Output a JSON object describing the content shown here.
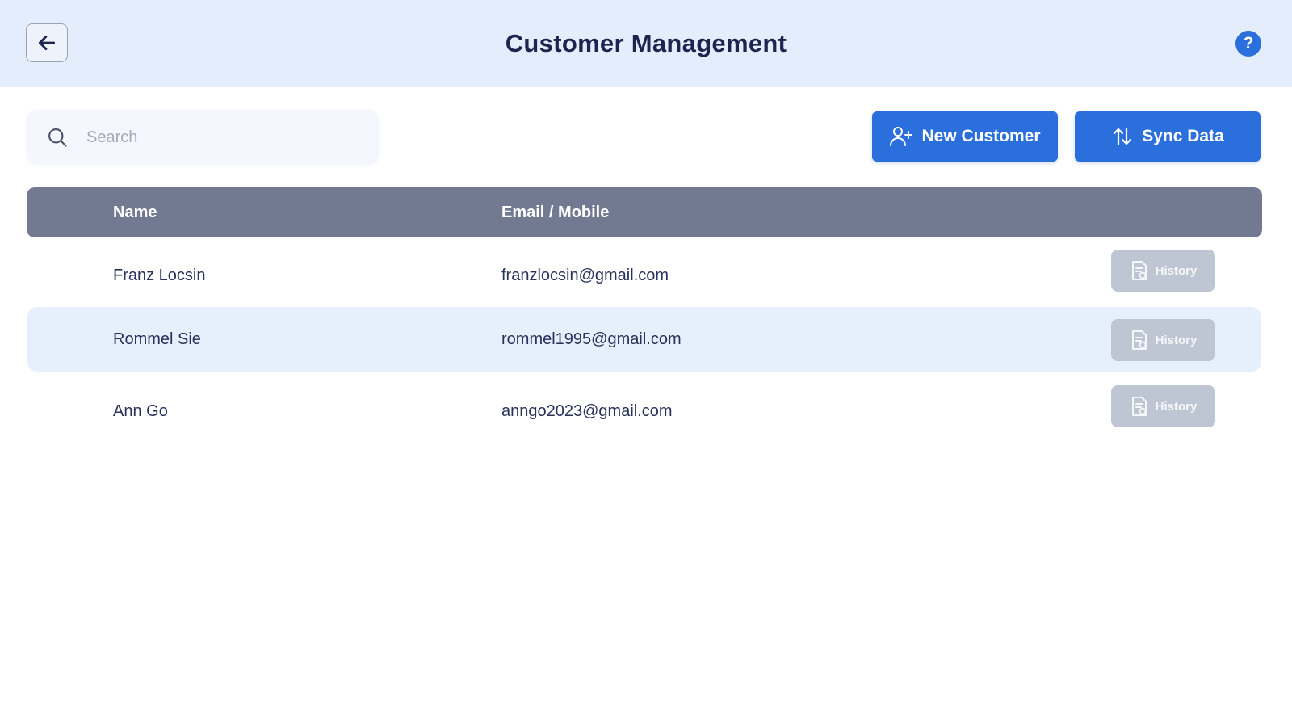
{
  "header": {
    "title": "Customer Management",
    "back_icon": "arrow-left-icon",
    "help_icon": "question-mark-icon",
    "help_glyph": "?"
  },
  "search": {
    "placeholder": "Search",
    "value": "",
    "icon": "search-icon"
  },
  "toolbar": {
    "new_customer_label": "New Customer",
    "new_customer_icon": "user-plus-icon",
    "sync_label": "Sync Data",
    "sync_icon": "sync-icon"
  },
  "table": {
    "columns": [
      "Name",
      "Email / Mobile"
    ],
    "rows": [
      {
        "name": "Franz Locsin",
        "contact": "franzlocsin@gmail.com",
        "action_label": "History"
      },
      {
        "name": "Rommel Sie",
        "contact": "rommel1995@gmail.com",
        "action_label": "History"
      },
      {
        "name": "Ann Go",
        "contact": "anngo2023@gmail.com",
        "action_label": "History"
      }
    ]
  },
  "colors": {
    "header_bg": "#e3edfb",
    "primary": "#2a6fdb",
    "table_header_bg": "#727a91",
    "row_highlight": "#e6effc",
    "history_button_bg": "#bfc6d3"
  }
}
